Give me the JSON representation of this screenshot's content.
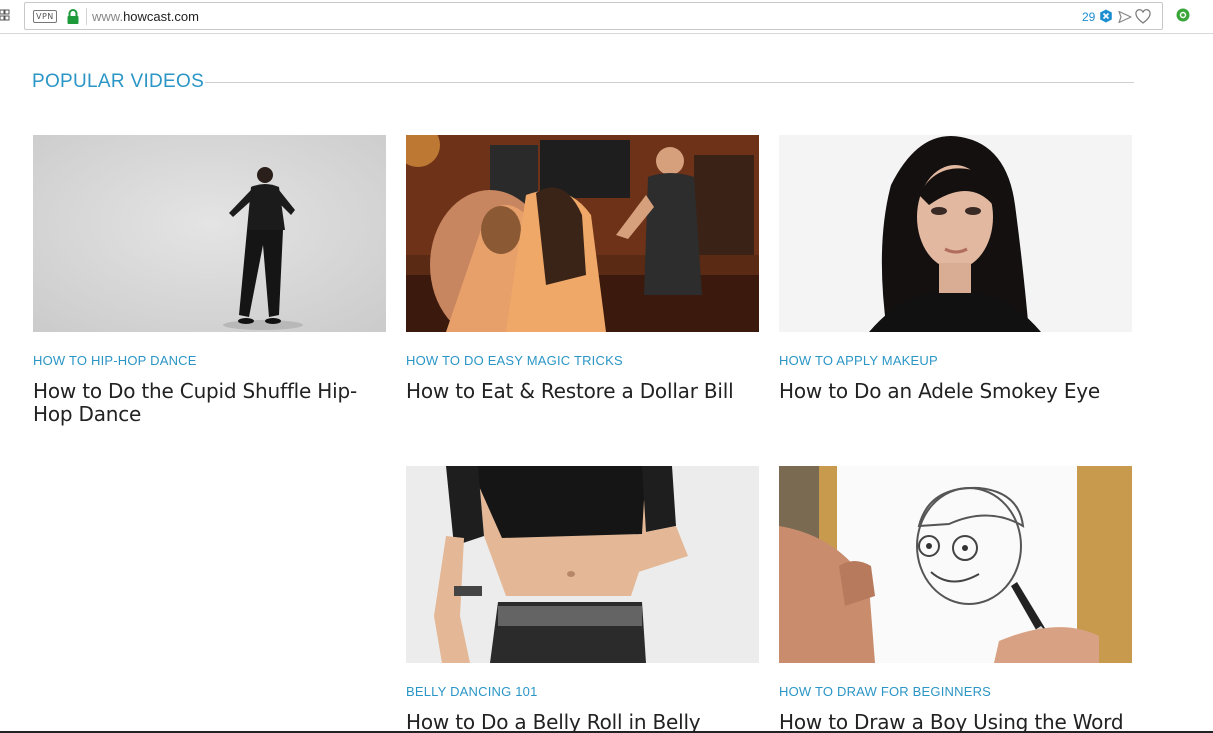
{
  "browser": {
    "vpn_label": "VPN",
    "url_prefix": "www.",
    "url_domain": "howcast.com",
    "ad_count": "29",
    "accent": "#1d8fd0"
  },
  "section": {
    "title": "POPULAR VIDEOS",
    "accent": "#2b96c6"
  },
  "videos": [
    {
      "category": "HOW TO HIP-HOP DANCE",
      "title": "How to Do the Cupid Shuffle Hip-Hop Dance"
    },
    {
      "category": "HOW TO DO EASY MAGIC TRICKS",
      "title": "How to Eat & Restore a Dollar Bill"
    },
    {
      "category": "HOW TO APPLY MAKEUP",
      "title": "How to Do an Adele Smokey Eye"
    },
    {
      "category": "BELLY DANCING 101",
      "title": "How to Do a Belly Roll in Belly"
    },
    {
      "category": "HOW TO DRAW FOR BEGINNERS",
      "title": "How to Draw a Boy Using the Word"
    }
  ]
}
